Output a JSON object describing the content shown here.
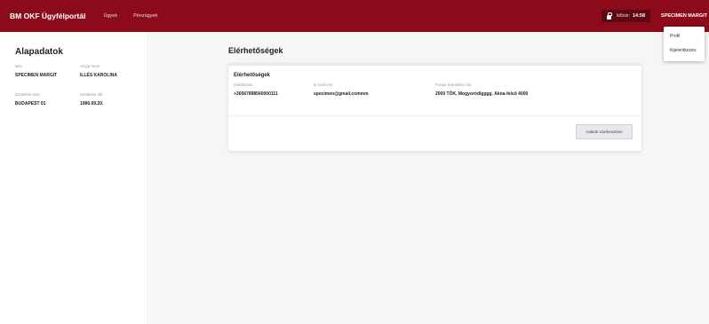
{
  "header": {
    "brand": "BM OKF Ügyfélportál",
    "nav": [
      "Ügyek",
      "Pénzügyek"
    ],
    "timer_label": "Időzár:",
    "timer_value": "14:58",
    "user": "SPECIMEN MARGIT"
  },
  "user_menu": {
    "items": [
      "Profil",
      "Kijelentkezés"
    ]
  },
  "sidebar": {
    "title": "Alapadatok",
    "fields": [
      {
        "label": "Név",
        "value": "SPECIMEN MARGIT"
      },
      {
        "label": "Anyja neve",
        "value": "ILLÉS KAROLINA"
      },
      {
        "label": "Születési hely",
        "value": "BUDAPEST 01"
      },
      {
        "label": "Születési idő",
        "value": "1986.09.20."
      }
    ]
  },
  "main": {
    "title": "Elérhetőségek",
    "card": {
      "title": "Elérhetőségek",
      "fields": [
        {
          "label": "Mobilszám",
          "value": "+36567898560000111"
        },
        {
          "label": "E-mail cím",
          "value": "specimen@gmail.commm"
        },
        {
          "label": "Postai értesítési cím",
          "value": "2000 TÓK, Mogyoródigggg. Akna-felső 4000"
        }
      ],
      "edit_label": "Adatok szerkesztése"
    }
  },
  "colors": {
    "navbar": "#8b0b1a",
    "timer_bg": "#5e0712",
    "background": "#f6f6f6"
  }
}
